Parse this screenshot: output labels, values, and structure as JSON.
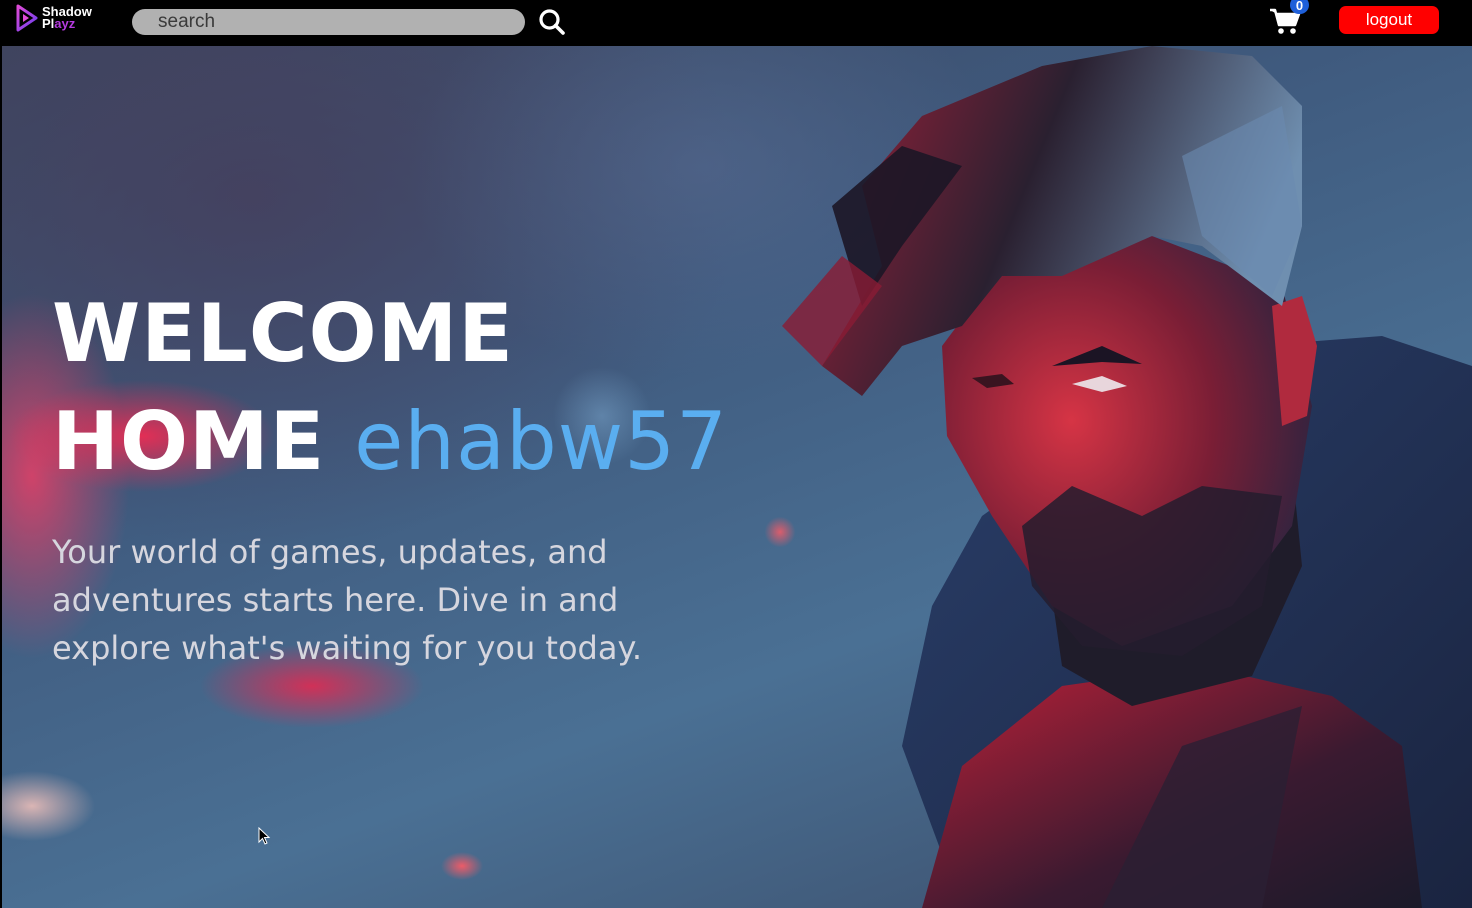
{
  "brand": {
    "line1": "Shadow",
    "line2_a": "Pl",
    "line2_b": "ayz",
    "accent_color": "#b53be0"
  },
  "search": {
    "placeholder": "search",
    "icon": "search-icon"
  },
  "cart": {
    "icon": "cart-icon",
    "count": "0",
    "badge_color": "#1e5fd9"
  },
  "logout": {
    "label": "logout",
    "color": "#ff0000"
  },
  "hero": {
    "headline_line1": "WELCOME",
    "headline_line2": "HOME",
    "username": "ehabw57",
    "username_color": "#5aaef0",
    "tagline": "Your world of games, updates, and adventures starts here. Dive in and explore what's waiting for you today."
  }
}
